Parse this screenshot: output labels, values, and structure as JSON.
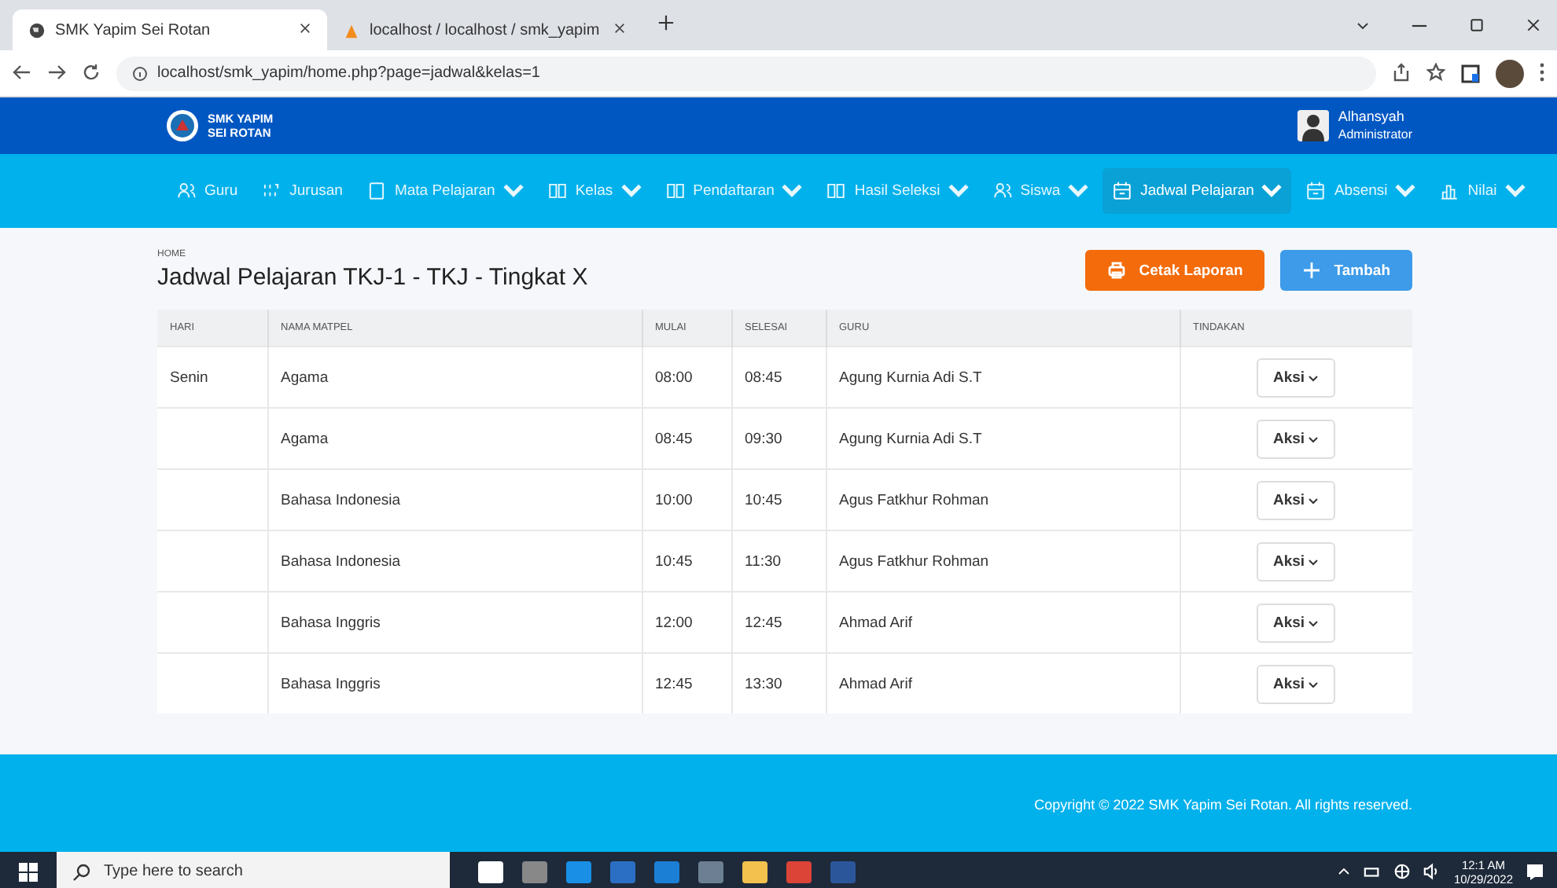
{
  "browser": {
    "tabs": [
      {
        "title": "SMK Yapim Sei Rotan",
        "selected": true
      },
      {
        "title": "localhost / localhost / smk_yapim",
        "selected": false
      }
    ],
    "url": "localhost/smk_yapim/home.php?page=jadwal&kelas=1"
  },
  "header": {
    "brand": [
      "SMK YAPIM",
      "SEI ROTAN"
    ],
    "user_name": "Alhansyah",
    "user_role": "Administrator"
  },
  "nav": [
    {
      "label": "Guru",
      "kind": "people",
      "dropdown": false,
      "selected": false
    },
    {
      "label": "Jurusan",
      "kind": "grid",
      "dropdown": false,
      "selected": false
    },
    {
      "label": "Mata Pelajaran",
      "kind": "square",
      "dropdown": true,
      "selected": false
    },
    {
      "label": "Kelas",
      "kind": "book",
      "dropdown": true,
      "selected": false
    },
    {
      "label": "Pendaftaran",
      "kind": "book",
      "dropdown": true,
      "selected": false
    },
    {
      "label": "Hasil Seleksi",
      "kind": "book",
      "dropdown": true,
      "selected": false
    },
    {
      "label": "Siswa",
      "kind": "people",
      "dropdown": true,
      "selected": false
    },
    {
      "label": "Jadwal Pelajaran",
      "kind": "calendar",
      "dropdown": true,
      "selected": true
    },
    {
      "label": "Absensi",
      "kind": "calendar",
      "dropdown": true,
      "selected": false
    },
    {
      "label": "Nilai",
      "kind": "chart",
      "dropdown": true,
      "selected": false
    }
  ],
  "page": {
    "breadcrumb": "HOME",
    "title": "Jadwal Pelajaran TKJ-1 - TKJ - Tingkat X",
    "buttons": [
      {
        "label": "Cetak Laporan",
        "kind": "print"
      },
      {
        "label": "Tambah",
        "kind": "add"
      }
    ]
  },
  "table": {
    "columns": [
      "HARI",
      "NAMA MATPEL",
      "MULAI",
      "SELESAI",
      "GURU",
      "TINDAKAN"
    ],
    "rows": [
      {
        "hari": "Senin",
        "matpel": "Agama",
        "mulai": "08:00",
        "selesai": "08:45",
        "guru": "Agung Kurnia Adi S.T",
        "action": "Aksi"
      },
      {
        "matpel": "Agama",
        "mulai": "08:45",
        "selesai": "09:30",
        "guru": "Agung Kurnia Adi S.T",
        "action": "Aksi"
      },
      {
        "matpel": "Bahasa Indonesia",
        "mulai": "10:00",
        "selesai": "10:45",
        "guru": "Agus Fatkhur Rohman",
        "action": "Aksi"
      },
      {
        "matpel": "Bahasa Indonesia",
        "mulai": "10:45",
        "selesai": "11:30",
        "guru": "Agus Fatkhur Rohman",
        "action": "Aksi"
      },
      {
        "matpel": "Bahasa Inggris",
        "mulai": "12:00",
        "selesai": "12:45",
        "guru": "Ahmad Arif",
        "action": "Aksi"
      },
      {
        "matpel": "Bahasa Inggris",
        "mulai": "12:45",
        "selesai": "13:30",
        "guru": "Ahmad Arif",
        "action": "Aksi"
      }
    ]
  },
  "footer": "Copyright © 2022 SMK Yapim Sei Rotan. All rights reserved.",
  "taskbar": {
    "search_placeholder": "Type here to search",
    "time": "12:1 AM",
    "date": "10/29/2022"
  }
}
